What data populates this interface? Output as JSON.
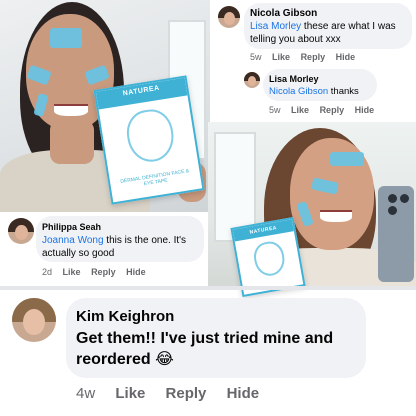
{
  "photos": {
    "first": {
      "box_brand": "NATUREA",
      "box_text": "DERMAL DEFINITION FACE & EYE TAPE"
    },
    "second": {
      "box_brand": "NATUREA"
    }
  },
  "comments": {
    "nicola": {
      "author": "Nicola Gibson",
      "mention": "Lisa Morley",
      "text": " these are what I was telling you about xxx",
      "time": "5w",
      "like": "Like",
      "reply": "Reply",
      "hide": "Hide"
    },
    "lisa": {
      "author": "Lisa Morley",
      "mention": "Nicola Gibson",
      "text": " thanks",
      "time": "5w",
      "like": "Like",
      "reply": "Reply",
      "hide": "Hide"
    },
    "philippa": {
      "author": "Philippa Seah",
      "mention": "Joanna Wong",
      "text": " this is the one. It's actually so good",
      "time": "2d",
      "like": "Like",
      "reply": "Reply",
      "hide": "Hide"
    },
    "kim": {
      "author": "Kim Keighron",
      "text": "Get them!! I've just tried mine and reordered 😂",
      "time": "4w",
      "like": "Like",
      "reply": "Reply",
      "hide": "Hide"
    }
  },
  "colors": {
    "mention": "#1b74e4",
    "bubble": "#f0f2f5",
    "meta": "#65676b",
    "tape": "#67c3e4",
    "box_accent": "#3fb1d5"
  }
}
